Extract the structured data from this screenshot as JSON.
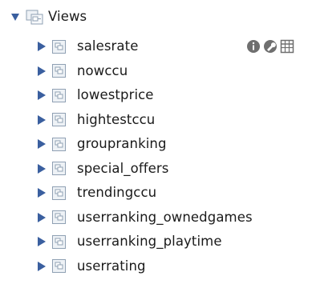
{
  "tree": {
    "root": {
      "label": "Views",
      "expanded": true,
      "toggle_icon": "expanded-triangle-icon",
      "icon": "views-folder-icon"
    },
    "items": [
      {
        "label": "salesrate",
        "icon": "view-icon",
        "expanded": false
      },
      {
        "label": "nowccu",
        "icon": "view-icon",
        "expanded": false
      },
      {
        "label": "lowestprice",
        "icon": "view-icon",
        "expanded": false
      },
      {
        "label": "hightestccu",
        "icon": "view-icon",
        "expanded": false
      },
      {
        "label": "groupranking",
        "icon": "view-icon",
        "expanded": false
      },
      {
        "label": "special_offers",
        "icon": "view-icon",
        "expanded": false
      },
      {
        "label": "trendingccu",
        "icon": "view-icon",
        "expanded": false
      },
      {
        "label": "userranking_ownedgames",
        "icon": "view-icon",
        "expanded": false
      },
      {
        "label": "userranking_playtime",
        "icon": "view-icon",
        "expanded": false
      },
      {
        "label": "userrating",
        "icon": "view-icon",
        "expanded": false
      }
    ],
    "hover_actions": [
      {
        "name": "info-icon"
      },
      {
        "name": "wrench-icon"
      },
      {
        "name": "table-grid-icon"
      }
    ]
  },
  "colors": {
    "triangle": "#3a5f9f",
    "text": "#1a1a1a",
    "icon_border": "#8fa0b3",
    "icon_fill": "#eef2f6",
    "action_icon": "#6f6f6f"
  }
}
